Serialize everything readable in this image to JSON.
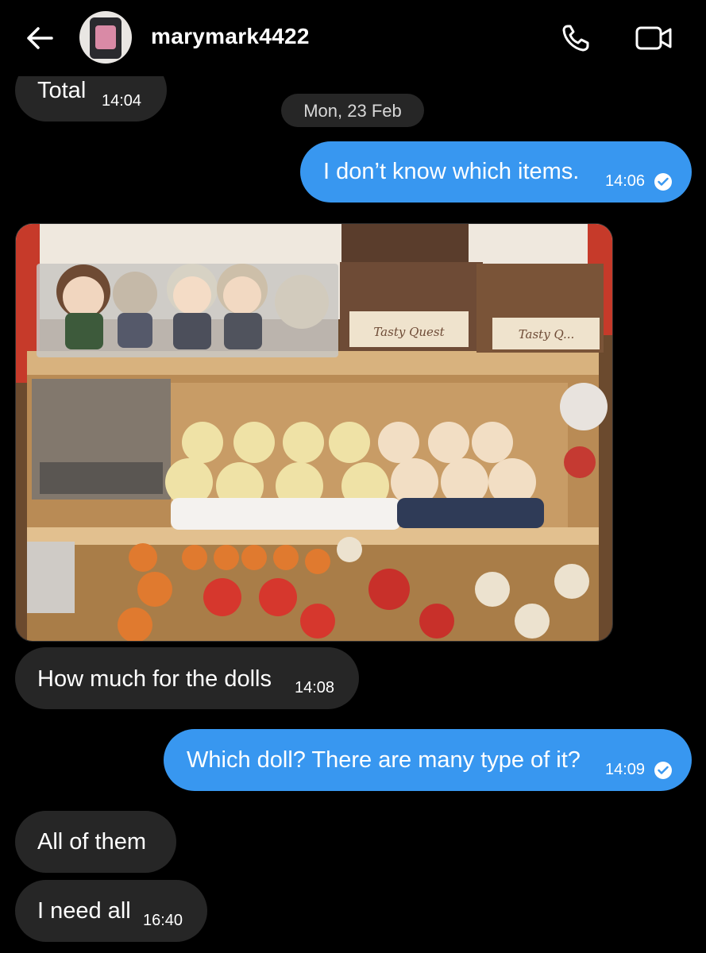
{
  "header": {
    "username": "marymark4422"
  },
  "icons": {
    "back": "back-arrow-icon",
    "call": "phone-icon",
    "video": "video-camera-icon",
    "read": "read-check-icon"
  },
  "colors": {
    "background": "#000000",
    "incoming_bubble": "#262626",
    "outgoing_bubble": "#3897f0"
  },
  "date_separator": "Mon, 23 Feb",
  "messages": [
    {
      "text": "Total",
      "time": "14:04",
      "direction": "incoming"
    },
    {
      "text": "I don’t know which items.",
      "time": "14:06",
      "direction": "outgoing",
      "read": true
    },
    {
      "type": "photo",
      "direction": "incoming"
    },
    {
      "text": "How much for the dolls",
      "time": "14:08",
      "direction": "incoming"
    },
    {
      "text": "Which doll? There are many type of it?",
      "time": "14:09",
      "direction": "outgoing",
      "read": true
    },
    {
      "text": "All of them",
      "time": "",
      "direction": "incoming"
    },
    {
      "text": "I need all",
      "time": "16:40",
      "direction": "incoming"
    }
  ],
  "photo": {
    "box_label_1": "Tasty Quest",
    "box_label_2": "Tasty Q..."
  }
}
